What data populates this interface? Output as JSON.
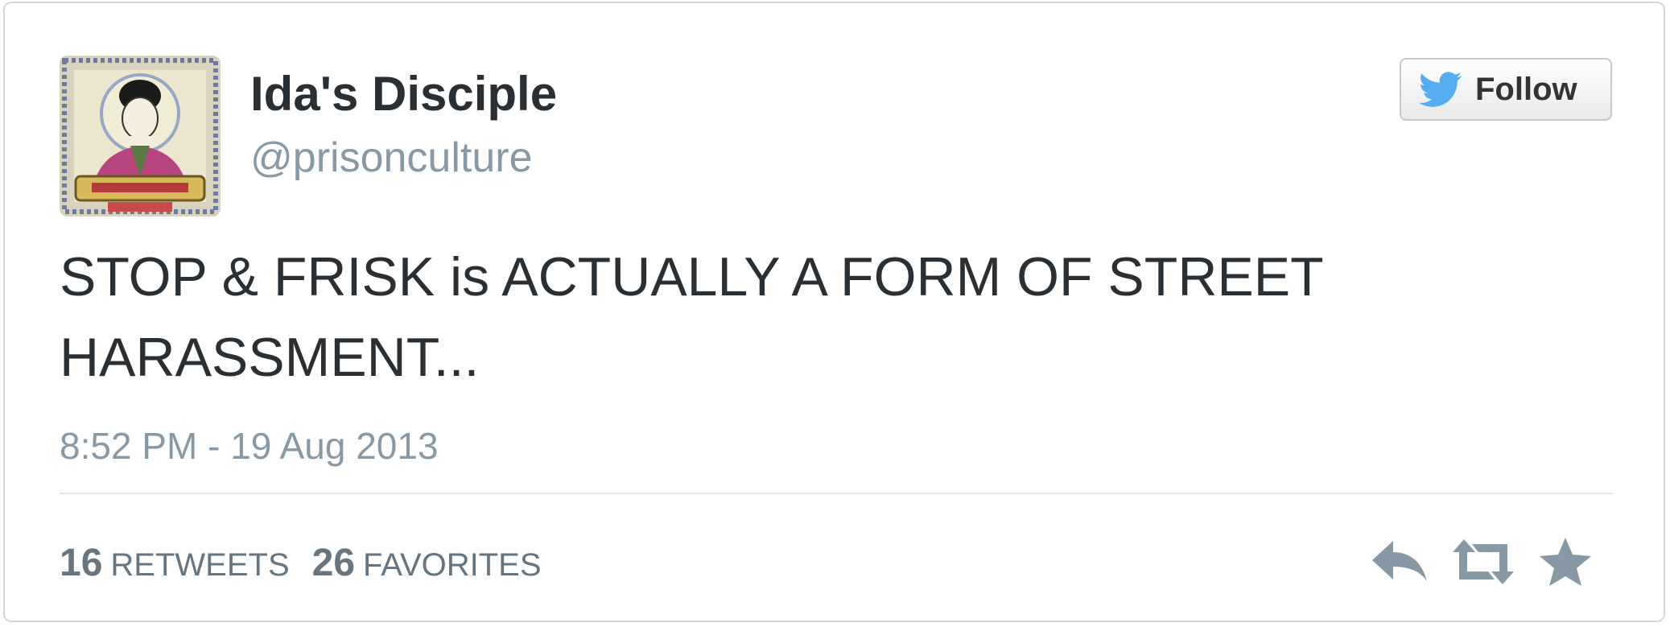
{
  "tweet": {
    "display_name": "Ida's Disciple",
    "screen_name": "@prisonculture",
    "follow_label": "Follow",
    "text": "STOP & FRISK is ACTUALLY A FORM OF STREET HARASSMENT...",
    "timestamp": "8:52 PM - 19 Aug 2013",
    "stats": {
      "retweets_count": "16",
      "retweets_label": "RETWEETS",
      "favorites_count": "26",
      "favorites_label": "FAVORITES"
    },
    "actions": {
      "reply_icon": "reply-icon",
      "retweet_icon": "retweet-icon",
      "favorite_icon": "star-icon"
    },
    "colors": {
      "name": "#292f33",
      "secondary": "#8899a6",
      "action_gray": "#8899a6",
      "twitter_blue": "#55acee"
    }
  }
}
